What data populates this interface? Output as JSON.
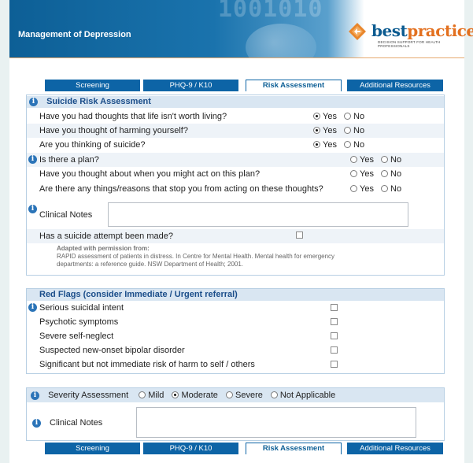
{
  "header": {
    "title": "Management of Depression",
    "digits": "1001010",
    "logo_best": "best",
    "logo_practice": "practice",
    "logo_tagline": "DECISION SUPPORT FOR HEALTH PROFESSIONALS"
  },
  "tabs": [
    {
      "label": "Screening",
      "active": false
    },
    {
      "label": "PHQ-9 / K10",
      "active": false
    },
    {
      "label": "Risk Assessment",
      "active": true
    },
    {
      "label": "Additional Resources",
      "active": false
    }
  ],
  "suicide": {
    "heading": "Suicide Risk Assessment",
    "questions": [
      {
        "text": "Have you had thoughts that life isn't worth living?",
        "selected": "Yes"
      },
      {
        "text": "Have you thought of harming yourself?",
        "selected": "Yes"
      },
      {
        "text": "Are you thinking of suicide?",
        "selected": "Yes"
      },
      {
        "text": "Is there a plan?",
        "selected": ""
      },
      {
        "text": "Have you thought about when you might act on this plan?",
        "selected": ""
      },
      {
        "text": "Are there any things/reasons that stop you from acting on these thoughts?",
        "selected": ""
      }
    ],
    "yes_label": "Yes",
    "no_label": "No",
    "clinical_notes_label": "Clinical Notes",
    "clinical_notes_value": "",
    "attempt_label": "Has a suicide attempt been made?",
    "attempt_checked": false,
    "cite_heading": "Adapted with permission from:",
    "cite_line1": "RAPID assessment of patients in distress. In Centre for Mental Health. Mental health for emergency",
    "cite_line2": "departments: a reference guide. NSW Department of Health; 2001."
  },
  "red_flags": {
    "heading": "Red Flags  (consider Immediate / Urgent referral)",
    "items": [
      {
        "label": "Serious suicidal intent",
        "checked": false
      },
      {
        "label": "Psychotic symptoms",
        "checked": false
      },
      {
        "label": "Severe self-neglect",
        "checked": false
      },
      {
        "label": "Suspected new-onset bipolar disorder",
        "checked": false
      },
      {
        "label": "Significant but not immediate risk of harm to self / others",
        "checked": false
      }
    ]
  },
  "severity": {
    "label": "Severity Assessment",
    "options": [
      "Mild",
      "Moderate",
      "Severe",
      "Not Applicable"
    ],
    "selected": "Moderate",
    "clinical_notes_label": "Clinical Notes",
    "clinical_notes_value": ""
  },
  "colors": {
    "tab_blue": "#0d64a6",
    "section_head": "#d9e6f2",
    "heading_text": "#1b4e8a",
    "logo_orange": "#e3701f"
  }
}
